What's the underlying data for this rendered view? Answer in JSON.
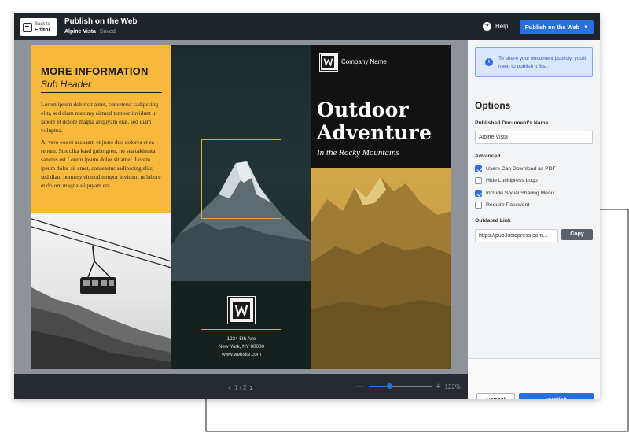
{
  "header": {
    "back_line1": "Back to",
    "back_line2": "Editor",
    "title": "Publish on the Web",
    "doc_name": "Alpine Vista",
    "status": "Saved",
    "help_label": "Help",
    "publish_dropdown_label": "Publish on the Web"
  },
  "brochure": {
    "panel1": {
      "heading": "MORE INFORMATION",
      "subheader": "Sub Header",
      "para1": "Lorem ipsum dolor sit amet, consetetur sadipscing elitr, sed diam nonumy eirmod tempor invidunt ut labore et dolore magna aliquyam erat, sed diam voluptua.",
      "para2": "At vero eos et accusam et justo duo dolores et ea rebum. Stet clita kasd gubergren, no sea takimata sanctus est Lorem ipsum dolor sit amet. Lorem ipsum dolor sit amet, consetetur sadipscing elitr, sed diam nonumy eirmod tempor invidunt ut labore et dolore magna aliquyam era."
    },
    "panel2": {
      "address1": "1234 5th Ave",
      "address2": "New York, NY 00000",
      "website": "www.website.com"
    },
    "panel3": {
      "company": "Company Name",
      "title1": "Outdoor",
      "title2": "Adventure",
      "subtitle": "In the Rocky Mountains"
    }
  },
  "bottombar": {
    "page_display": "1 / 2",
    "zoom_label": "122%",
    "zoom_fraction": 0.32
  },
  "options": {
    "info_text": "To share your document publicly, you'll need to publish it first.",
    "title": "Options",
    "name_label": "Published Document's Name",
    "name_value": "Alpine Vista",
    "advanced_label": "Advanced",
    "checkboxes": [
      {
        "label": "Users Can Download as PDF",
        "checked": true
      },
      {
        "label": "Hide Lucidpress Logo",
        "checked": false
      },
      {
        "label": "Include Social Sharing Menu",
        "checked": true
      },
      {
        "label": "Require Password",
        "checked": false
      }
    ],
    "link_label": "Outdated Link",
    "link_value": "https://pub.lucidpress.com...",
    "copy_label": "Copy",
    "cancel_label": "Cancel",
    "publish_label": "Publish"
  },
  "colors": {
    "accent_blue": "#2a6fe0",
    "brochure_yellow": "#f6b93b",
    "gold_frame": "#d9a74a"
  },
  "icons": [
    "back-icon",
    "help-icon",
    "chevron-down-icon",
    "info-icon",
    "chevron-left-icon",
    "chevron-right-icon",
    "zoom-out-icon",
    "zoom-in-icon",
    "checkmark-icon"
  ]
}
